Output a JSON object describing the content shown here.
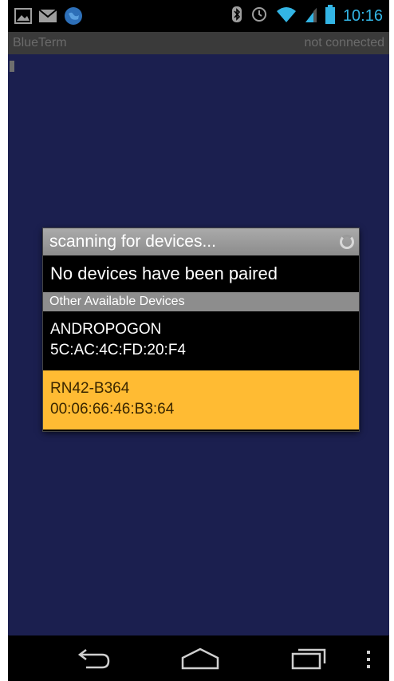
{
  "status_bar": {
    "time": "10:16",
    "left_icons": [
      "image-icon",
      "mail-icon",
      "globe-icon"
    ],
    "right_icons": [
      "bluetooth-icon",
      "alarm-icon",
      "wifi-icon",
      "signal-icon",
      "battery-icon"
    ],
    "accent_color": "#33b5e5"
  },
  "app": {
    "title": "BlueTerm",
    "connection_status": "not connected",
    "terminal_bg": "#1b1f4f"
  },
  "dialog": {
    "title": "scanning for devices...",
    "paired_message": "No devices have been paired",
    "section_header": "Other Available Devices",
    "devices": [
      {
        "name": "ANDROPOGON",
        "address": "5C:AC:4C:FD:20:F4",
        "selected": false
      },
      {
        "name": "RN42-B364",
        "address": "00:06:66:46:B3:64",
        "selected": true
      }
    ],
    "highlight_color": "#ffbb33"
  },
  "nav_bar": {
    "buttons": [
      "back-icon",
      "home-icon",
      "recents-icon",
      "menu-icon"
    ]
  }
}
